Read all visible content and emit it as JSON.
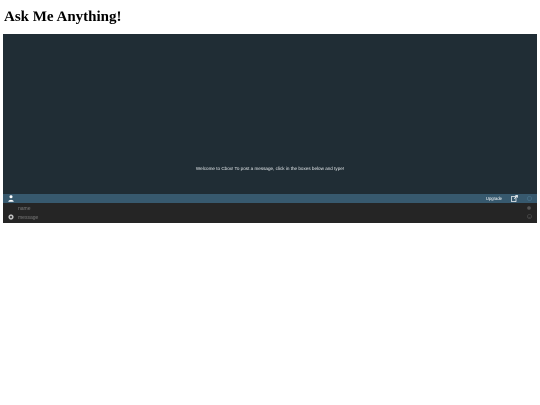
{
  "page": {
    "title": "Ask Me Anything!"
  },
  "chat": {
    "welcome_message": "Welcome to Cbox! To post a message, click in the boxes below and type!",
    "toolbar": {
      "upgrade_label": "Upgrade",
      "icons": {
        "user": "user-icon",
        "popout": "external-link-icon",
        "status": "status-icon"
      }
    },
    "inputs": {
      "name_placeholder": "name",
      "message_placeholder": "message",
      "name_value": "",
      "message_value": ""
    },
    "colors": {
      "background": "#202d35",
      "toolbar": "#37596e",
      "input_area": "#252525"
    }
  }
}
